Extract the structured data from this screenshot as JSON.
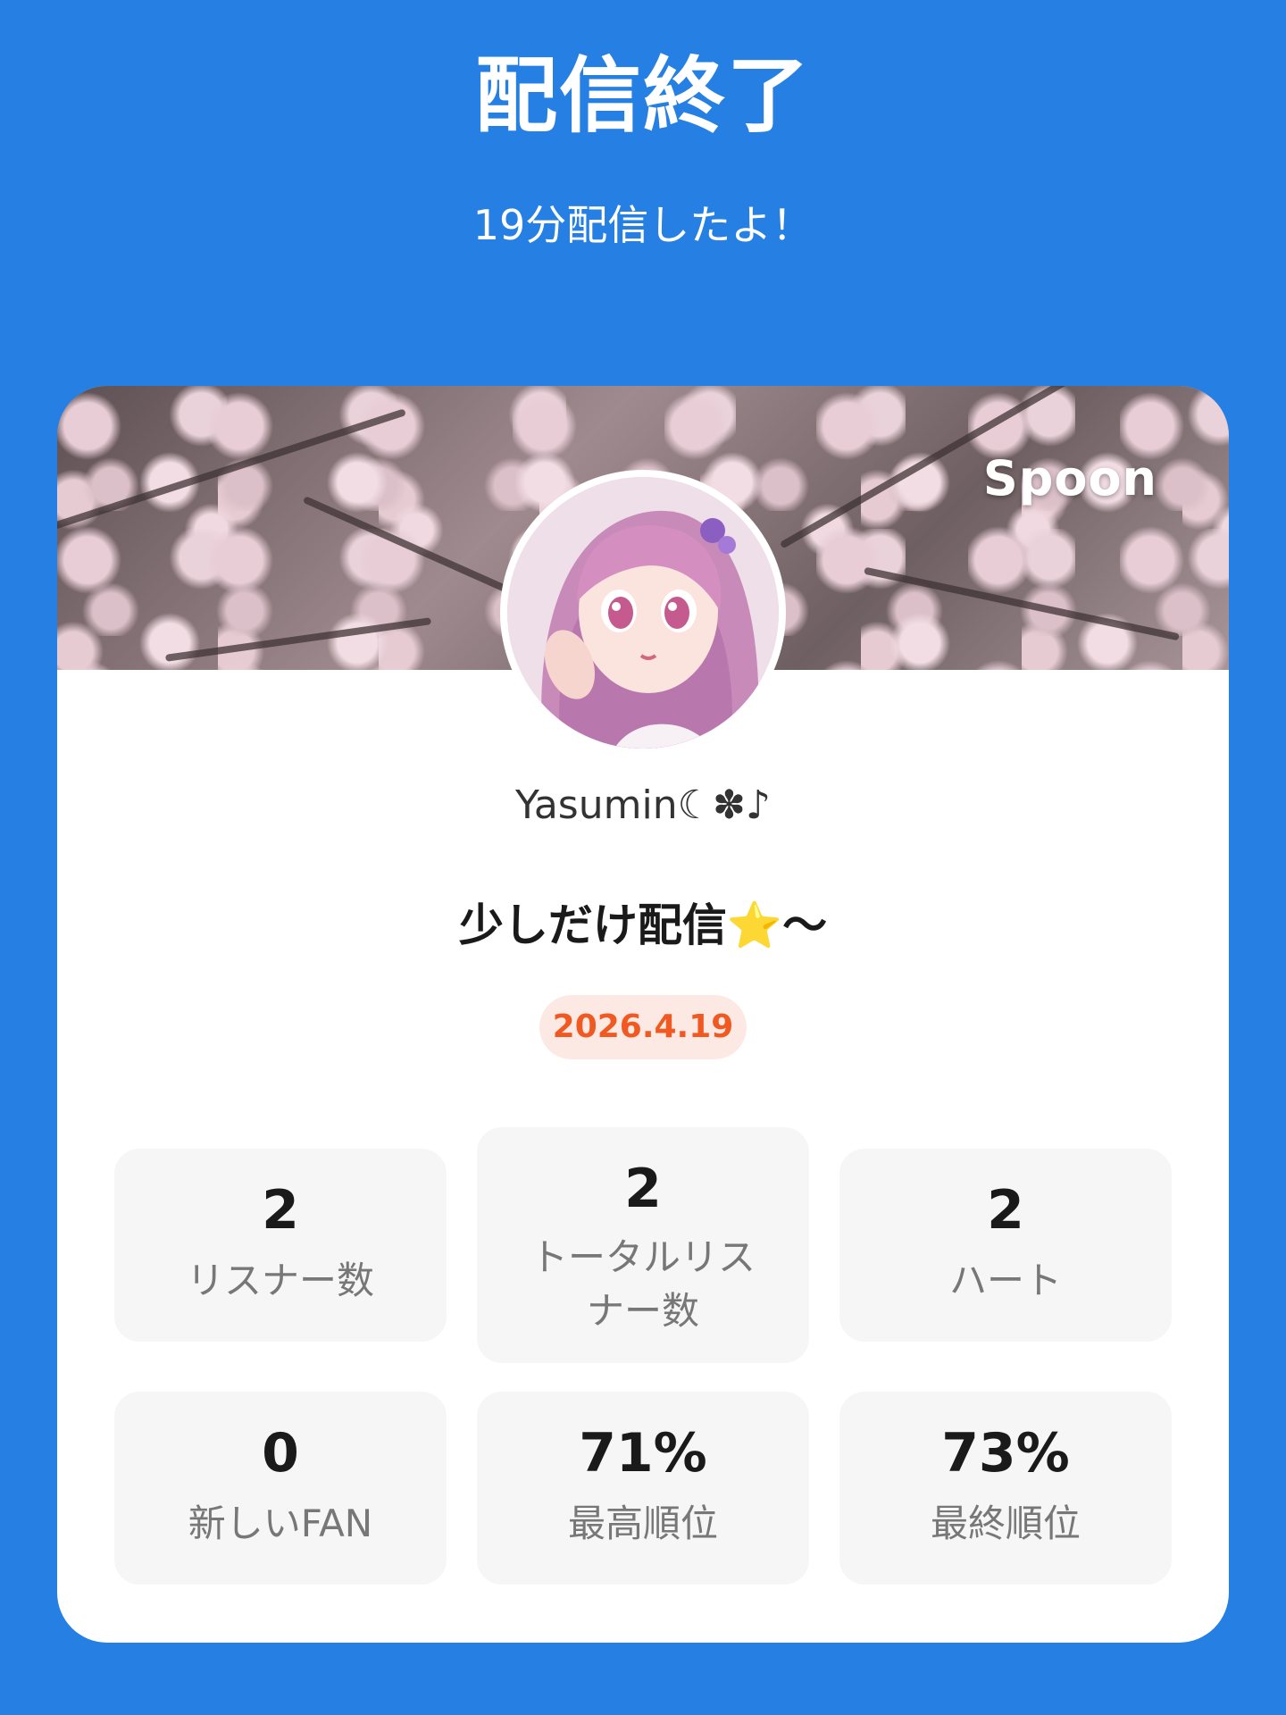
{
  "header": {
    "title": "配信終了",
    "subtitle": "19分配信したよ！"
  },
  "card": {
    "brand": "Spoon",
    "username": "Yasumin☾✽♪",
    "stream_title": "少しだけ配信⭐️～",
    "date": "2026.4.19",
    "accent_color": "#f05a22",
    "background_color": "#2680e3"
  },
  "stats": [
    {
      "value": "2",
      "label": "リスナー数"
    },
    {
      "value": "2",
      "label": "トータルリスナー数"
    },
    {
      "value": "2",
      "label": "ハート"
    },
    {
      "value": "0",
      "label": "新しいFAN"
    },
    {
      "value": "71%",
      "label": "最高順位"
    },
    {
      "value": "73%",
      "label": "最終順位"
    }
  ]
}
